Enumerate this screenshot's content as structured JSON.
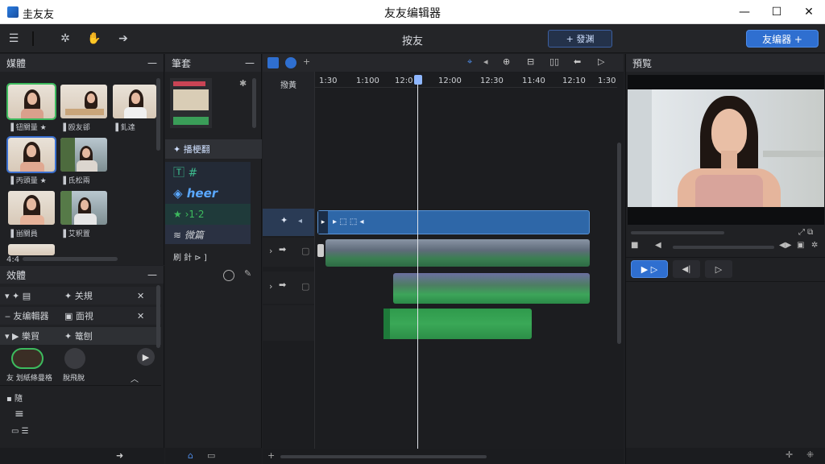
{
  "window": {
    "app_title": "圭友友",
    "center_title": "友友编辑器",
    "minimize": "—",
    "maximize": "☐",
    "close": "✕"
  },
  "toolbar": {
    "project_title": "按友",
    "export_label": "+ 發渊",
    "editor_label": "友编器 +",
    "accent": "#2f6fd0"
  },
  "media_panel": {
    "title": "媒體",
    "items": [
      {
        "caption": "▐ 钮關量 ★"
      },
      {
        "caption": "▐ 殴友郤"
      },
      {
        "caption": "▐ 釓達"
      },
      {
        "caption": "▐ 丙頭量 ★"
      },
      {
        "caption": "▐ 氐松兩"
      },
      {
        "caption": "▐ 畄關員"
      },
      {
        "caption": "▐ 艾釈置"
      }
    ],
    "scroll_label": "4:4"
  },
  "effects_panel": {
    "title": "效體",
    "rows": [
      {
        "label": "▾ ✦ ▤",
        "label2": "✦ 关規"
      },
      {
        "label": "‒ 友编輯器",
        "label2": "▣ 面視"
      },
      {
        "label": "▾ ▶ 樂貿",
        "label2": "✦ 篭刨"
      }
    ],
    "transitions": [
      {
        "caption": "友 划紙條曼格"
      },
      {
        "caption": "脫飛脫"
      }
    ],
    "footer": [
      {
        "label": "▪ 隨"
      },
      {
        "label": "≡"
      },
      {
        "label": "▭ ☰"
      }
    ]
  },
  "mid_panel": {
    "title": "筆套",
    "section_label": "✦ 播梗翻",
    "items": [
      {
        "label": "🅃 #"
      },
      {
        "label": "◈ heer"
      },
      {
        "label": "★ ›1·2"
      },
      {
        "label": "≋ 微篇"
      }
    ],
    "footer_label": "刷 針 ⊳ ]"
  },
  "timeline": {
    "ruler_label": "撥黃",
    "ticks": [
      "1:30",
      "1:100",
      "12:0",
      "12:00",
      "12:30",
      "11:40",
      "12:10",
      "1:30"
    ],
    "video_clip_label": "▸ ⬚ ⬚ ◂",
    "scrollbar_label": "+"
  },
  "preview": {
    "title": "預覧",
    "play_label": "▶ ▷",
    "prev_label": "◀|",
    "next_label": "▷"
  }
}
